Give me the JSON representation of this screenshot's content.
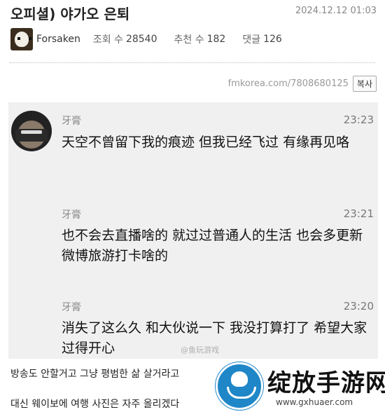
{
  "post": {
    "title": "오피셜) 야가오 은퇴",
    "date": "2024.12.12 01:03",
    "author": "Forsaken",
    "views_label": "조회 수",
    "views": "28540",
    "votes_label": "추천 수",
    "votes": "182",
    "comments_label": "댓글",
    "comments": "126",
    "source_url": "fmkorea.com/7808680125",
    "copy_label": "복사"
  },
  "messages": [
    {
      "name": "牙膏",
      "time": "23:23",
      "text": "天空不曾留下我的痕迹 但我已经飞过 有缘再见咯"
    },
    {
      "name": "牙膏",
      "time": "23:21",
      "text": "也不会去直播啥的 就过过普通人的生活 也会多更新微博旅游打卡啥的"
    },
    {
      "name": "牙膏",
      "time": "23:20",
      "text": "消失了这么久 和大伙说一下 我没打算打了 希望大家过得开心"
    }
  ],
  "watermark": "@鱼玩游戏",
  "korean_lines": [
    "방송도 안할거고 그냥 평범한 삶 살거라고",
    "대신 웨이보에 여행 사진은 자주 올리겠다"
  ],
  "logo": {
    "text": "绽放手游网",
    "url": "www.gxhuaer.com",
    "brand_color": "#1f86c8"
  }
}
